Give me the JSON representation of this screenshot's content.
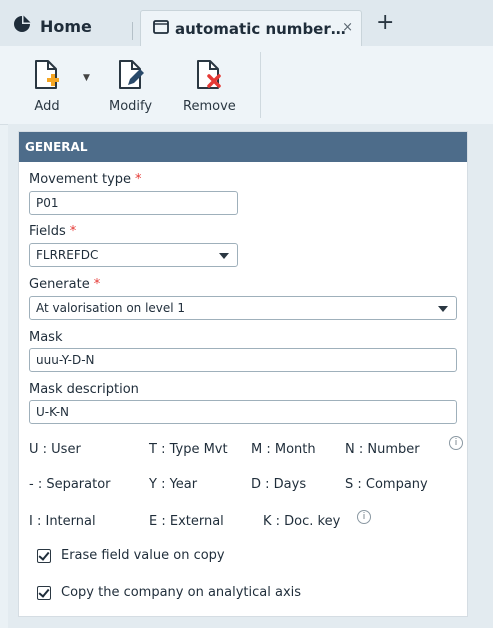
{
  "tabs": {
    "home_label": "Home",
    "active_label": "automatic number…",
    "close_glyph": "×",
    "add_glyph": "+"
  },
  "toolbar": {
    "add_label": "Add",
    "modify_label": "Modify",
    "remove_label": "Remove"
  },
  "section": {
    "title": "GENERAL"
  },
  "form": {
    "movement_type": {
      "label": "Movement type",
      "value": "P01",
      "required": "*"
    },
    "fields": {
      "label": "Fields",
      "value": "FLRREFDC",
      "required": "*"
    },
    "generate": {
      "label": "Generate",
      "value": "At valorisation on level 1",
      "required": "*"
    },
    "mask": {
      "label": "Mask",
      "value": "uuu-Y-D-N"
    },
    "mask_description": {
      "label": "Mask description",
      "value": "U-K-N"
    }
  },
  "legend": {
    "row1": [
      "U : User",
      "T : Type Mvt",
      "M : Month",
      "N : Number"
    ],
    "row2": [
      "- : Separator",
      "Y : Year",
      "D : Days",
      "S : Company"
    ],
    "row3": [
      "I : Internal",
      "E : External",
      "K : Doc. key"
    ],
    "info_glyph": "i"
  },
  "checkboxes": {
    "erase_label": "Erase field value on copy",
    "erase_checked": true,
    "copy_company_label": "Copy the company on analytical axis",
    "copy_company_checked": true
  },
  "colors": {
    "header_bg": "#4d6c8a",
    "required": "#e53935",
    "add_accent": "#f5a623",
    "remove_accent": "#e53935",
    "modify_accent": "#2a4a6a"
  },
  "icons": {
    "home": "home-icon",
    "document": "document-icon",
    "add": "add-document-icon",
    "modify": "modify-document-icon",
    "remove": "remove-document-icon"
  }
}
